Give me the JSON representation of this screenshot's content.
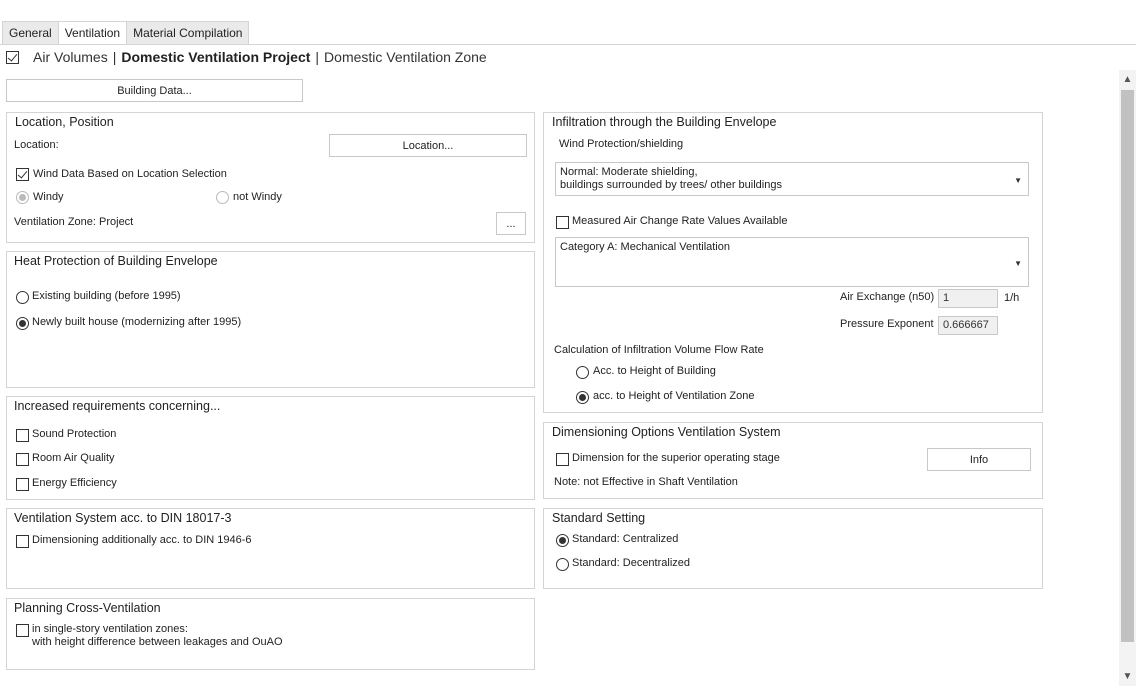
{
  "tabs": [
    "General",
    "Ventilation",
    "Material Compilation"
  ],
  "breadcrumb": {
    "checked": true,
    "items": [
      "Air Volumes",
      "Domestic Ventilation Project",
      "Domestic Ventilation Zone"
    ]
  },
  "building_data_button": "Building Data...",
  "location": {
    "title": "Location, Position",
    "location_label": "Location:",
    "location_button": "Location...",
    "wind_data_label": "Wind Data Based on Location Selection",
    "windy_label": "Windy",
    "not_windy_label": "not Windy",
    "zone_label": "Ventilation Zone: Project",
    "zone_button": "..."
  },
  "heat_protection": {
    "title": "Heat Protection of Building Envelope",
    "option_existing": "Existing building (before 1995)",
    "option_new": "Newly built house (modernizing after 1995)"
  },
  "increased_requirements": {
    "title": "Increased requirements concerning...",
    "sound": "Sound Protection",
    "air_quality": "Room Air Quality",
    "energy": "Energy Efficiency"
  },
  "din_system": {
    "title": "Ventilation System acc. to DIN 18017-3",
    "dimensioning": "Dimensioning additionally acc. to DIN 1946-6"
  },
  "cross_ventilation": {
    "title": "Planning Cross-Ventilation",
    "line1": "in single-story ventilation zones:",
    "line2": "with height difference between leakages and OuAO"
  },
  "infiltration": {
    "title": "Infiltration through the Building Envelope",
    "wind_label": "Wind Protection/shielding",
    "wind_combo_line1": "Normal: Moderate shielding,",
    "wind_combo_line2": "buildings surrounded by trees/ other buildings",
    "measured_label": "Measured Air Change Rate Values Available",
    "category_combo": "Category A: Mechanical Ventilation",
    "air_exchange_label": "Air Exchange (n50)",
    "air_exchange_value": "1",
    "air_exchange_unit": "1/h",
    "pressure_label": "Pressure Exponent",
    "pressure_value": "0.666667",
    "calc_label": "Calculation of Infiltration Volume Flow Rate",
    "option_building": "Acc. to Height of Building",
    "option_zone": "acc. to Height of Ventilation Zone"
  },
  "dimensioning_options": {
    "title": "Dimensioning Options Ventilation System",
    "superior_label": "Dimension for the superior operating stage",
    "info_button": "Info",
    "note": "Note: not Effective in Shaft Ventilation"
  },
  "standard_setting": {
    "title": "Standard Setting",
    "centralized": "Standard: Centralized",
    "decentralized": "Standard: Decentralized"
  },
  "scrollbar": {
    "up": "▲",
    "down": "▼"
  }
}
